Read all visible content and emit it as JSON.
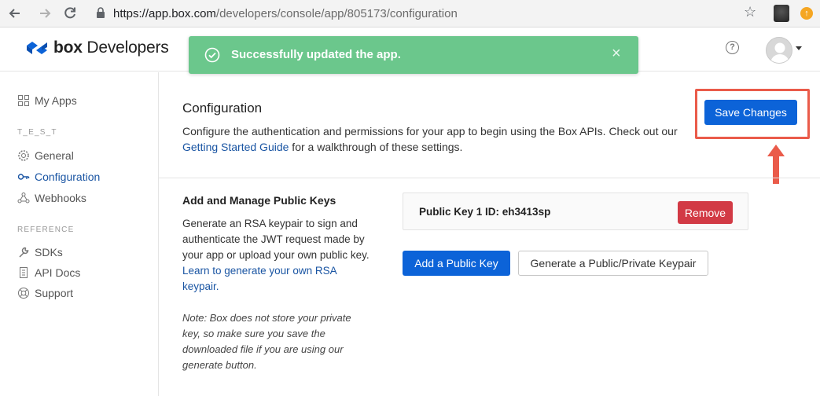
{
  "browser": {
    "url_host": "https://app.box.com",
    "url_path": "/developers/console/app/805173/configuration"
  },
  "header": {
    "logo_box": "box",
    "logo_developers": "Developers",
    "help_symbol": "?",
    "toast": {
      "message": "Successfully updated the app.",
      "close_symbol": "×",
      "color": "#6bc78c"
    }
  },
  "sidebar": {
    "items_top": [
      {
        "label": "My Apps",
        "icon": "apps-grid-icon"
      }
    ],
    "section_test": "T_E_S_T",
    "items_test": [
      {
        "label": "General",
        "icon": "gear-icon"
      },
      {
        "label": "Configuration",
        "icon": "key-icon",
        "active": true
      },
      {
        "label": "Webhooks",
        "icon": "webhook-icon"
      }
    ],
    "section_reference": "REFERENCE",
    "items_reference": [
      {
        "label": "SDKs",
        "icon": "wrench-icon"
      },
      {
        "label": "API Docs",
        "icon": "document-icon"
      },
      {
        "label": "Support",
        "icon": "lifebuoy-icon"
      }
    ]
  },
  "configuration": {
    "title": "Configuration",
    "desc_before": "Configure the authentication and permissions for your app to begin using the Box APIs. Check out our ",
    "desc_link": "Getting Started Guide",
    "desc_after": " for a walkthrough of these settings.",
    "save_label": "Save Changes"
  },
  "public_keys": {
    "title": "Add and Manage Public Keys",
    "desc": "Generate an RSA keypair to sign and authenticate the JWT request made by your app or upload your own public key. ",
    "desc_link": "Learn to generate your own RSA keypair.",
    "note": "Note: Box does not store your private key, so make sure you save the downloaded file if you are using our generate button.",
    "key_id": "Public Key 1 ID: eh3413sp",
    "remove_label": "Remove",
    "add_label": "Add a Public Key",
    "generate_label": "Generate a Public/Private Keypair"
  },
  "colors": {
    "primary": "#0c63d8",
    "danger": "#d23a45",
    "link": "#1a55a3",
    "highlight": "#ea5b4a"
  }
}
